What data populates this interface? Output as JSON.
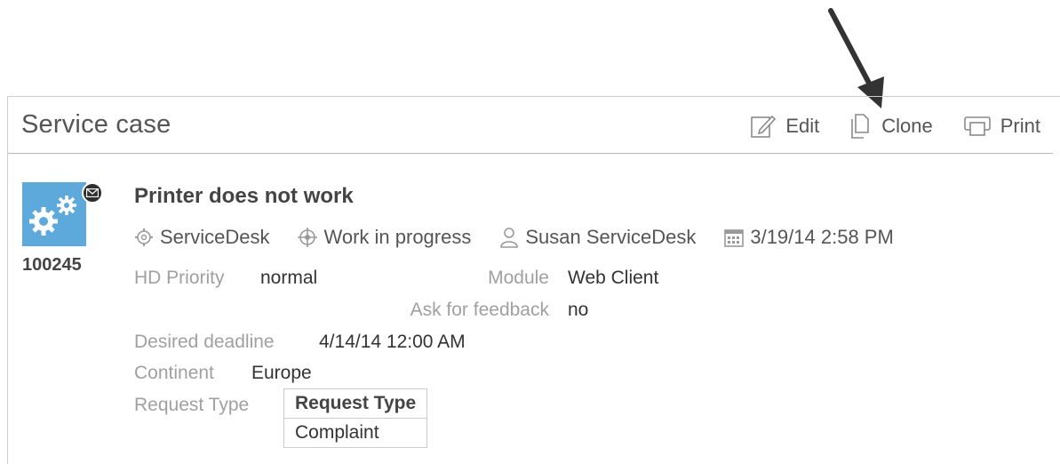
{
  "header": {
    "title": "Service case",
    "actions": [
      {
        "label": "Edit",
        "icon": "edit-icon"
      },
      {
        "label": "Clone",
        "icon": "clone-icon"
      },
      {
        "label": "Print",
        "icon": "print-icon"
      }
    ]
  },
  "case": {
    "id": "100245",
    "title": "Printer does not work",
    "meta": {
      "category": "ServiceDesk",
      "status": "Work in progress",
      "person": "Susan ServiceDesk",
      "date": "3/19/14 2:58 PM"
    },
    "fields": {
      "hd_priority": {
        "label": "HD Priority",
        "value": "normal"
      },
      "module": {
        "label": "Module",
        "value": "Web Client"
      },
      "ask_feedback": {
        "label": "Ask for feedback",
        "value": "no"
      },
      "desired_deadline": {
        "label": "Desired deadline",
        "value": "4/14/14 12:00 AM"
      },
      "continent": {
        "label": "Continent",
        "value": "Europe"
      },
      "request_type": {
        "label": "Request Type",
        "table_header": "Request Type",
        "rows": [
          "Complaint"
        ]
      }
    }
  },
  "colors": {
    "avatar_bg": "#5da9dc",
    "label": "#a0a0a0",
    "text": "#333333"
  }
}
